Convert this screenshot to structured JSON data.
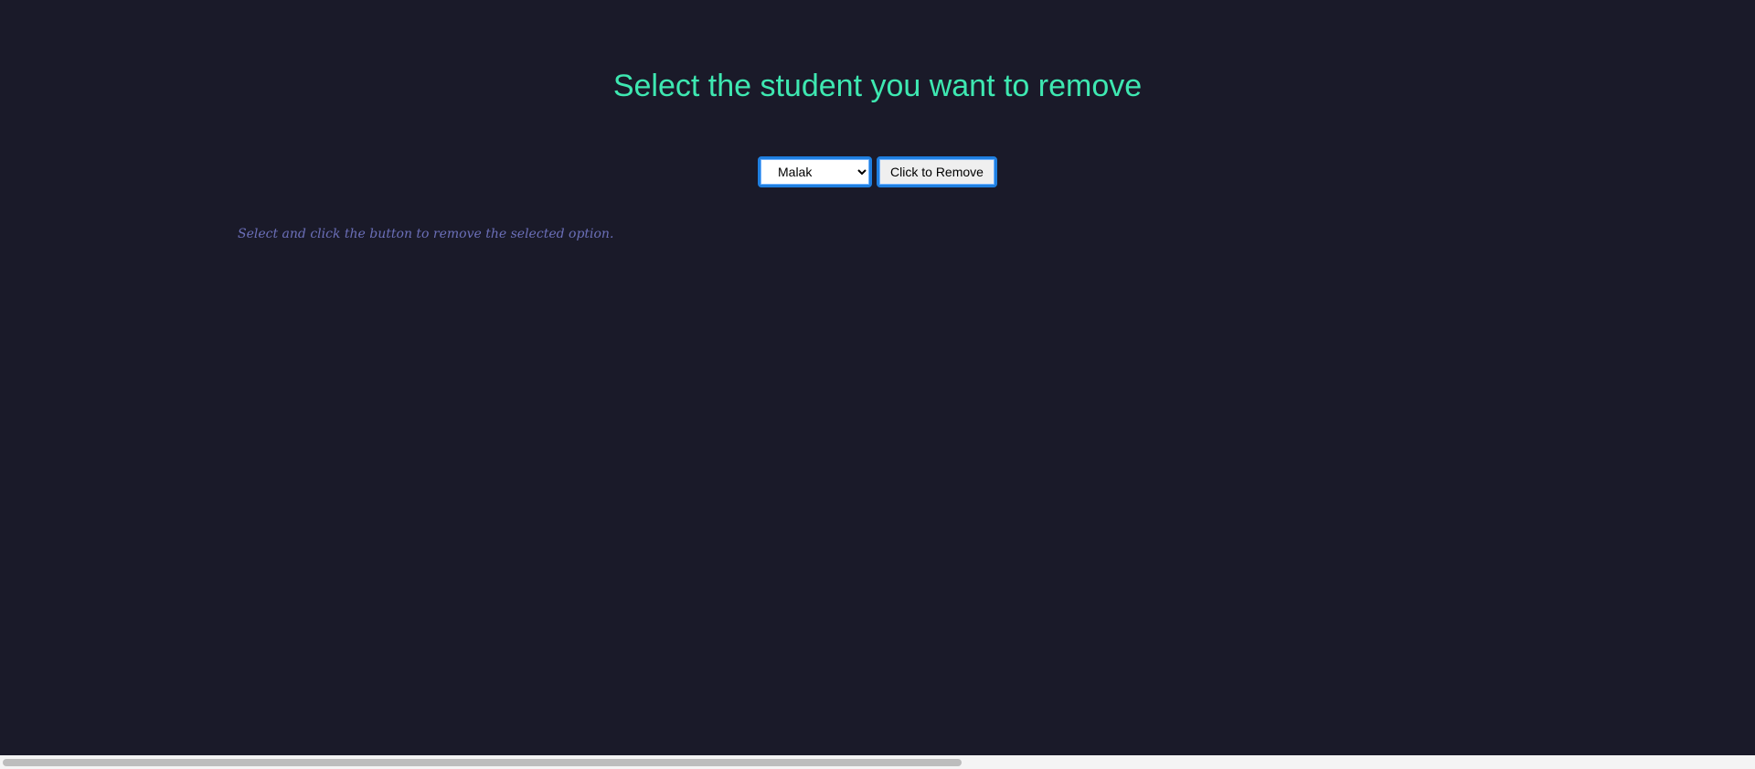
{
  "heading": "Select the student you want to remove",
  "student_select": {
    "selected": "Malak",
    "options": [
      "Malak"
    ]
  },
  "remove_button_label": "Click to Remove",
  "hint_text": "Select and click the button to remove the selected option.",
  "colors": {
    "background": "#1a1a29",
    "heading": "#3ee8b1",
    "hint": "#6b6fb8",
    "focus_border": "#1f7fe0"
  }
}
